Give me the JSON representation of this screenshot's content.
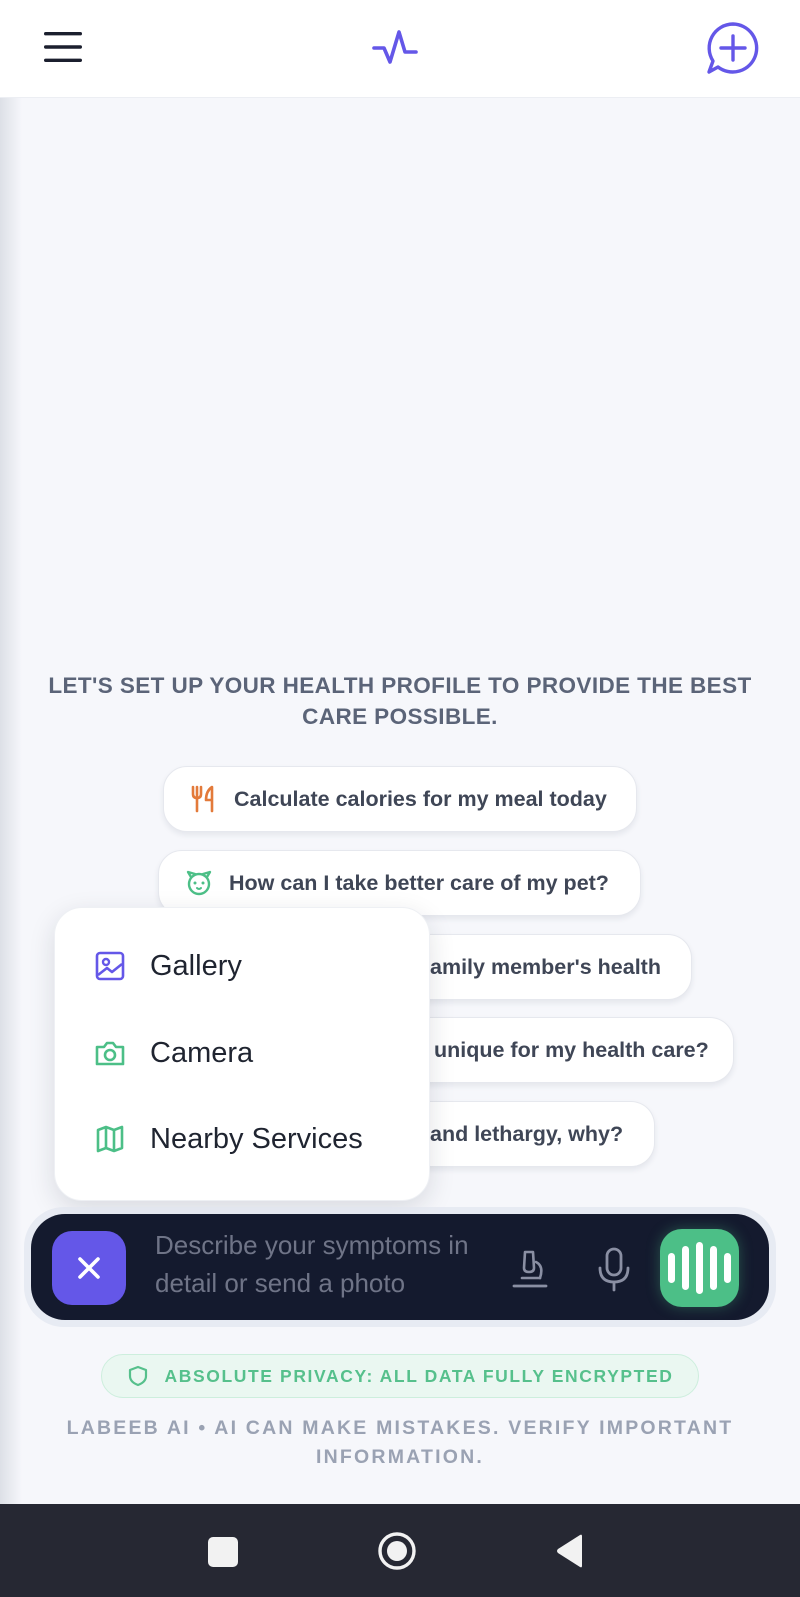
{
  "header": {
    "menu_icon": "hamburger-menu-icon",
    "logo_icon": "pulse-activity-icon",
    "new_chat_icon": "message-plus-icon"
  },
  "welcome": {
    "text": "LET'S SET UP YOUR HEALTH PROFILE TO PROVIDE THE BEST CARE POSSIBLE."
  },
  "suggestions": [
    {
      "label": "Calculate calories for my meal today",
      "icon": "utensils-icon",
      "color": "#e37a3a"
    },
    {
      "label": "How can I take better care of my pet?",
      "icon": "pet-paw-icon",
      "color": "#4cbf87"
    },
    {
      "label": "amily member's health"
    },
    {
      "label": "unique for my health care?"
    },
    {
      "label": "and lethargy, why?"
    }
  ],
  "attach_menu": {
    "items": [
      {
        "label": "Gallery",
        "icon": "image-icon",
        "color": "#6457e8"
      },
      {
        "label": "Camera",
        "icon": "camera-icon",
        "color": "#4cbf87"
      },
      {
        "label": "Nearby Services",
        "icon": "map-icon",
        "color": "#4cbf87"
      }
    ]
  },
  "composer": {
    "placeholder": "Describe your symptoms in detail or send a photo",
    "close_icon": "close-icon",
    "lab_icon": "microscope-icon",
    "mic_icon": "microphone-icon",
    "voice_icon": "voice-wave-icon",
    "accent": "#6457e8",
    "voice_color": "#4cbf87"
  },
  "privacy": {
    "text": "ABSOLUTE PRIVACY: ALL DATA FULLY ENCRYPTED",
    "icon": "shield-icon"
  },
  "disclaimer": {
    "text": "LABEEB AI • AI CAN MAKE MISTAKES. VERIFY IMPORTANT INFORMATION."
  },
  "system_nav": {
    "recents_icon": "square-recents-icon",
    "home_icon": "circle-home-icon",
    "back_icon": "triangle-back-icon"
  }
}
